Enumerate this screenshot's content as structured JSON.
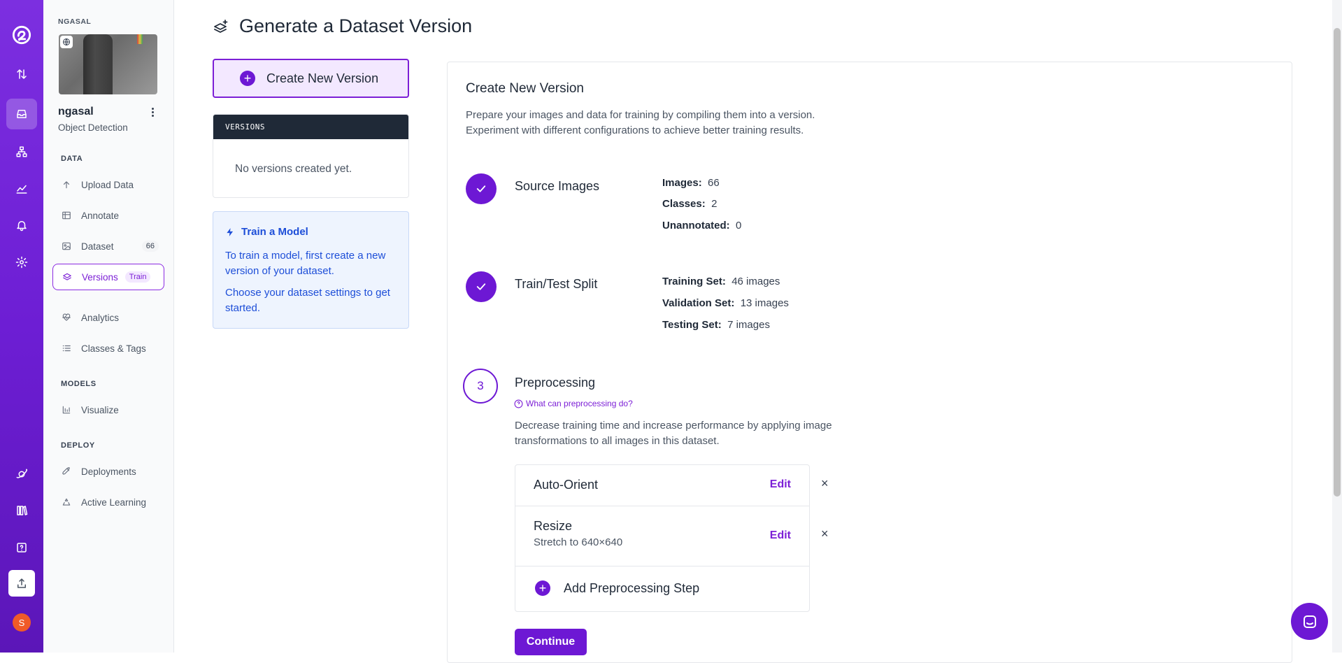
{
  "rail": {
    "items": [
      {
        "name": "logo",
        "icon": "roboflow-logo-icon"
      },
      {
        "name": "sort",
        "icon": "sort-arrows-icon"
      },
      {
        "name": "projects",
        "icon": "inbox-icon",
        "active": true
      },
      {
        "name": "workflows",
        "icon": "sitemap-icon"
      },
      {
        "name": "analytics",
        "icon": "chart-icon"
      },
      {
        "name": "notifications",
        "icon": "bell-icon"
      },
      {
        "name": "settings",
        "icon": "gear-icon"
      },
      {
        "name": "universe",
        "icon": "planet-icon"
      },
      {
        "name": "docs",
        "icon": "books-icon"
      },
      {
        "name": "help",
        "icon": "help-icon"
      },
      {
        "name": "upload",
        "icon": "upload-icon"
      }
    ],
    "avatar_letter": "S",
    "avatar_color": "#f05a28"
  },
  "sidebar": {
    "workspace": "NGASAL",
    "project_name": "ngasal",
    "project_type": "Object Detection",
    "sections": {
      "data": "DATA",
      "models": "MODELS",
      "deploy": "DEPLOY"
    },
    "items": {
      "upload": "Upload Data",
      "annotate": "Annotate",
      "dataset": "Dataset",
      "dataset_count": "66",
      "versions": "Versions",
      "versions_badge": "Train",
      "analytics": "Analytics",
      "classes": "Classes & Tags",
      "visualize": "Visualize",
      "deployments": "Deployments",
      "active_learning": "Active Learning"
    }
  },
  "header": {
    "title": "Generate a Dataset Version"
  },
  "left_panel": {
    "create_button": "Create New Version",
    "versions_header": "VERSIONS",
    "versions_empty": "No versions created yet.",
    "train_title": "Train a Model",
    "train_text1": "To train a model, first create a new version of your dataset.",
    "train_text2": "Choose your dataset settings to get started."
  },
  "card": {
    "title": "Create New Version",
    "desc_line1": "Prepare your images and data for training by compiling them into a version.",
    "desc_line2": "Experiment with different configurations to achieve better training results.",
    "steps": {
      "source": {
        "title": "Source Images",
        "images_label": "Images:",
        "images_value": "66",
        "classes_label": "Classes:",
        "classes_value": "2",
        "unannotated_label": "Unannotated:",
        "unannotated_value": "0"
      },
      "split": {
        "title": "Train/Test Split",
        "train_label": "Training Set:",
        "train_value": "46 images",
        "valid_label": "Validation Set:",
        "valid_value": "13 images",
        "test_label": "Testing Set:",
        "test_value": "7 images"
      },
      "preprocessing": {
        "number": "3",
        "title": "Preprocessing",
        "help_link": "What can preprocessing do?",
        "desc": "Decrease training time and increase performance by applying image transformations to all images in this dataset.",
        "rows": [
          {
            "name": "Auto-Orient",
            "sub": "",
            "edit": "Edit"
          },
          {
            "name": "Resize",
            "sub": "Stretch to 640×640",
            "edit": "Edit"
          }
        ],
        "add_step": "Add Preprocessing Step",
        "continue": "Continue"
      }
    }
  },
  "colors": {
    "brand": "#7c1fd6",
    "rail_bg": "#6d1ed4",
    "dark_header": "#1f2937",
    "info_bg": "#eef4fe",
    "info_text": "#1d4ed8"
  }
}
